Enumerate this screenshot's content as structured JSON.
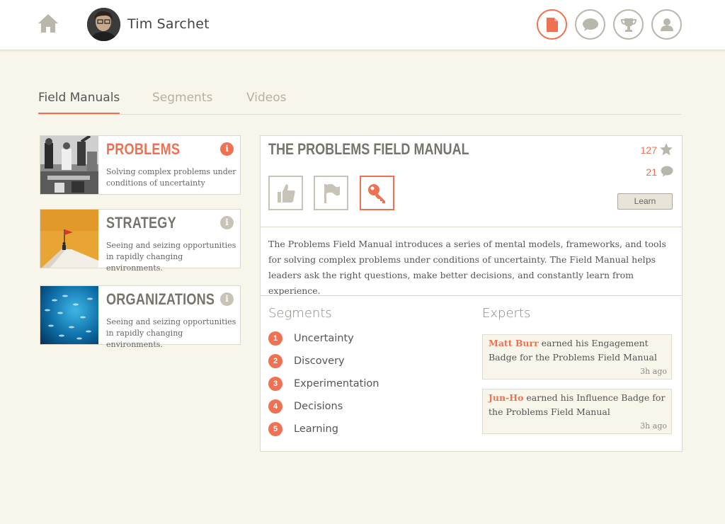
{
  "header": {
    "user_name": "Tim Sarchet",
    "icons": [
      "home-icon",
      "document-icon",
      "chat-icon",
      "trophy-icon",
      "profile-icon"
    ]
  },
  "tabs": [
    {
      "label": "Field Manuals",
      "active": true
    },
    {
      "label": "Segments",
      "active": false
    },
    {
      "label": "Videos",
      "active": false
    }
  ],
  "manuals": [
    {
      "title": "PROBLEMS",
      "description": "Solving complex problems under conditions of uncertainty",
      "active": true
    },
    {
      "title": "STRATEGY",
      "description": "Seeing and seizing opportunities in rapidly changing environments.",
      "active": false
    },
    {
      "title": "ORGANIZATIONS",
      "description": "Seeing and seizing opportunities in rapidly changing environments.",
      "active": false
    }
  ],
  "info_glyph": "i",
  "detail": {
    "title": "THE PROBLEMS FIELD MANUAL",
    "star_count": "127",
    "comment_count": "21",
    "learn_label": "Learn",
    "description": "The Problems Field Manual introduces a series of mental models, frameworks, and tools for solving complex problems under conditions of uncertainty. The Field Manual helps leaders ask the right questions, make better decisions, and constantly learn from experience.",
    "segments_heading": "Segments",
    "experts_heading": "Experts",
    "segments": [
      {
        "num": "1",
        "label": "Uncertainty"
      },
      {
        "num": "2",
        "label": "Discovery"
      },
      {
        "num": "3",
        "label": "Experimentation"
      },
      {
        "num": "4",
        "label": "Decisions"
      },
      {
        "num": "5",
        "label": "Learning"
      }
    ],
    "experts": [
      {
        "name": "Matt Burr",
        "text": " earned his Engagement Badge for the Problems Field Manual",
        "time": "3h ago"
      },
      {
        "name": "Jun-Ho",
        "text": " earned his Influence Badge for the Problems Field Manual",
        "time": "3h ago"
      }
    ]
  },
  "colors": {
    "accent": "#ef7152",
    "background": "#f8f5ea",
    "muted": "#c7c3b6"
  }
}
